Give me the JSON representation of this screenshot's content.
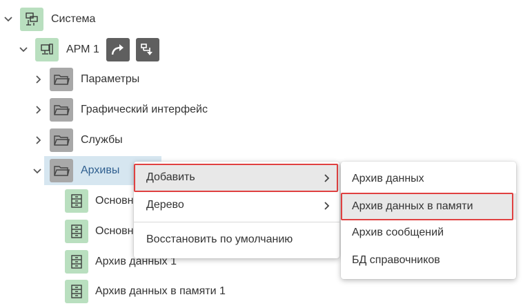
{
  "tree": {
    "root": {
      "label": "Система",
      "icon": "system-icon"
    },
    "arm": {
      "label": "АРМ 1",
      "icon": "workstation-icon",
      "buttons": [
        "redirect-icon",
        "download-config-icon"
      ]
    },
    "folders": [
      {
        "label": "Параметры",
        "icon": "folder-icon"
      },
      {
        "label": "Графический интерфейс",
        "icon": "folder-icon"
      },
      {
        "label": "Службы",
        "icon": "folder-icon"
      },
      {
        "label": "Архивы",
        "icon": "folder-icon"
      }
    ],
    "archive_items": [
      {
        "label": "Основн",
        "icon": "archive-icon"
      },
      {
        "label": "Основн",
        "icon": "archive-icon"
      },
      {
        "label": "Архив данных 1",
        "icon": "archive-icon"
      },
      {
        "label": "Архив данных в памяти 1",
        "icon": "archive-icon"
      }
    ]
  },
  "context_menu": {
    "items": [
      "Добавить",
      "Дерево",
      "Восстановить по умолчанию"
    ]
  },
  "submenu": {
    "items": [
      "Архив данных",
      "Архив данных в памяти",
      "Архив сообщений",
      "БД справочников"
    ]
  },
  "colors": {
    "green_tile": "#b9dfbf",
    "gray_tile": "#a8a8a8",
    "dark_button": "#5f5f5f",
    "selection": "#d6e6f0",
    "highlight_border": "#e04040"
  }
}
